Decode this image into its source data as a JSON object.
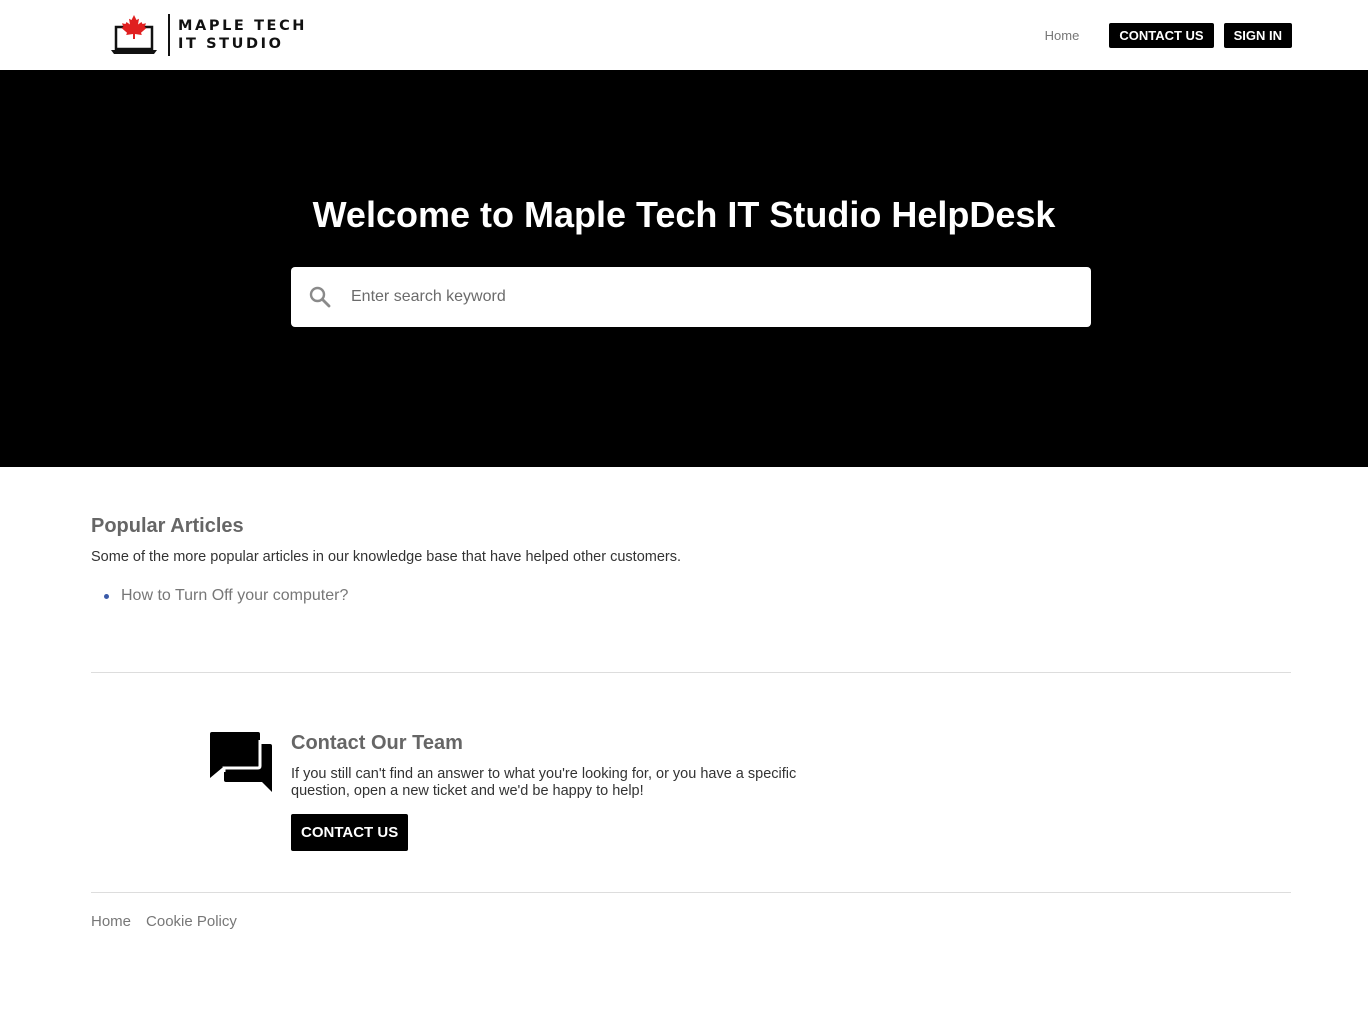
{
  "header": {
    "logo_line1": "MAPLE TECH",
    "logo_line2": "IT STUDIO",
    "nav_home": "Home",
    "nav_contact": "CONTACT US",
    "nav_signin": "SIGN IN"
  },
  "hero": {
    "title": "Welcome to Maple Tech IT Studio HelpDesk",
    "search_placeholder": "Enter search keyword"
  },
  "popular": {
    "title": "Popular Articles",
    "description": "Some of the more popular articles in our knowledge base that have helped other customers.",
    "articles": [
      "How to Turn Off your computer?"
    ]
  },
  "contact": {
    "title": "Contact Our Team",
    "description": "If you still can't find an answer to what you're looking for, or you have a specific question, open a new ticket and we'd be happy to help!",
    "button": "CONTACT US"
  },
  "footer": {
    "links": [
      "Home",
      "Cookie Policy"
    ]
  },
  "colors": {
    "hero_bg": "#000000",
    "button_bg": "#000000",
    "bullet": "#3a5aa8",
    "maple_leaf": "#e02020"
  },
  "icons": {
    "logo": "maple-leaf-laptop-icon",
    "search": "search-icon",
    "contact": "chat-bubbles-icon"
  }
}
